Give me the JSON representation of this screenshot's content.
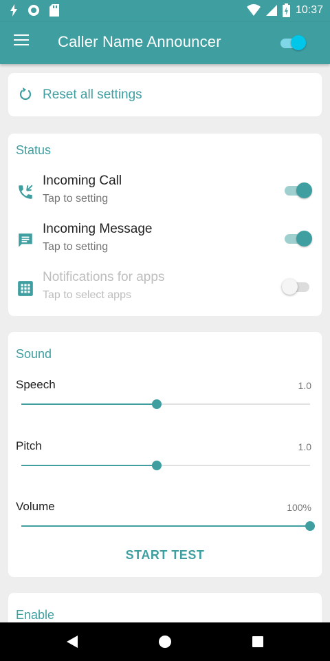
{
  "status_bar": {
    "time": "10:37",
    "icons": [
      "flash-icon",
      "sync-circle-icon",
      "sd-card-icon",
      "wifi-icon",
      "signal-icon",
      "battery-charging-icon"
    ]
  },
  "app_bar": {
    "title": "Caller Name Announcer",
    "master_switch_on": true
  },
  "reset": {
    "label": "Reset all settings"
  },
  "status": {
    "title": "Status",
    "items": [
      {
        "icon": "phone-incoming-icon",
        "label": "Incoming Call",
        "subtitle": "Tap to setting",
        "enabled": true,
        "on": true
      },
      {
        "icon": "message-icon",
        "label": "Incoming Message",
        "subtitle": "Tap to setting",
        "enabled": true,
        "on": true
      },
      {
        "icon": "apps-grid-icon",
        "label": "Notifications for apps",
        "subtitle": "Tap to select apps",
        "enabled": false,
        "on": false
      }
    ]
  },
  "sound": {
    "title": "Sound",
    "sliders": [
      {
        "label": "Speech",
        "value_text": "1.0",
        "fraction": 0.47
      },
      {
        "label": "Pitch",
        "value_text": "1.0",
        "fraction": 0.47
      },
      {
        "label": "Volume",
        "value_text": "100%",
        "fraction": 1.0
      }
    ],
    "start_test_label": "START TEST"
  },
  "enable": {
    "title": "Enable"
  },
  "colors": {
    "accent": "#3f9ea0",
    "master_switch": "#00c6ea"
  }
}
